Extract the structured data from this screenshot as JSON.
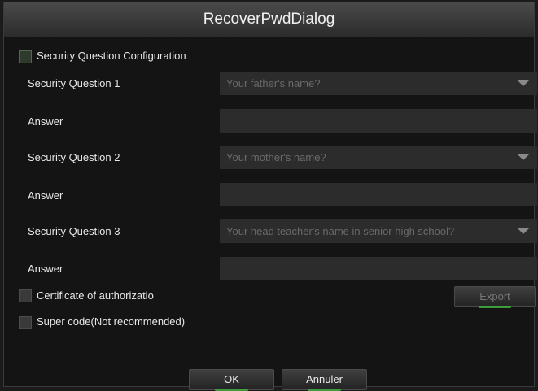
{
  "dialog": {
    "title": "RecoverPwdDialog"
  },
  "security_config": {
    "label": "Security Question Configuration"
  },
  "questions": [
    {
      "label": "Security Question 1",
      "value": "Your father's name?",
      "answer_label": "Answer"
    },
    {
      "label": "Security Question 2",
      "value": "Your mother's name?",
      "answer_label": "Answer"
    },
    {
      "label": "Security Question 3",
      "value": "Your head teacher's name in senior high school?",
      "answer_label": "Answer"
    }
  ],
  "certificate": {
    "label": "Certificate of authorizatio",
    "export_label": "Export"
  },
  "super_code": {
    "label": "Super code(Not recommended)"
  },
  "footer": {
    "ok_label": "OK",
    "cancel_label": "Annuler"
  },
  "colors": {
    "accent": "#3fae3f",
    "panel": "#2c2c2c"
  }
}
